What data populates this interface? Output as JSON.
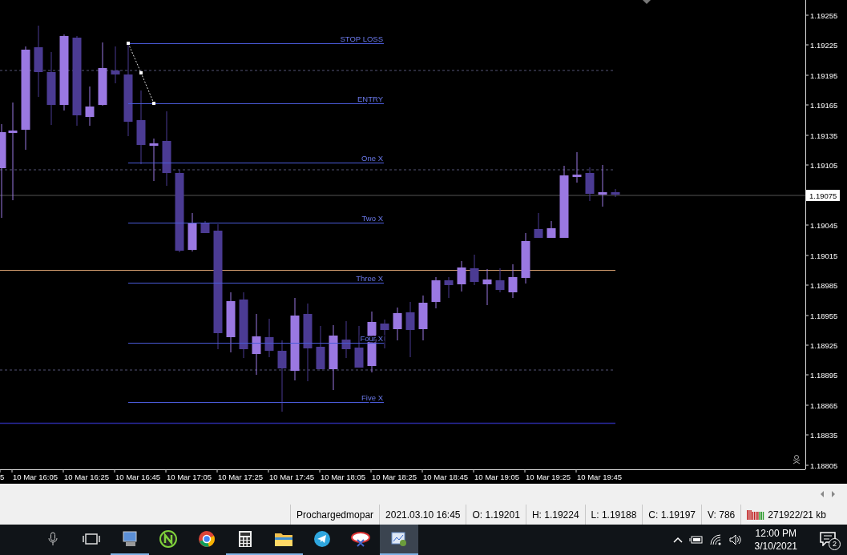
{
  "chart": {
    "levels": [
      {
        "label": "STOP LOSS"
      },
      {
        "label": "ENTRY"
      },
      {
        "label": "One X"
      },
      {
        "label": "Two X"
      },
      {
        "label": "Three X"
      },
      {
        "label": "Four X"
      },
      {
        "label": "Five X"
      }
    ],
    "price_labels": [
      "1.19255",
      "1.19225",
      "1.19195",
      "1.19165",
      "1.19135",
      "1.19105",
      "1.19045",
      "1.19015",
      "1.18985",
      "1.18955",
      "1.18925",
      "1.18895",
      "1.18865",
      "1.18835",
      "1.18805"
    ],
    "current_price": "1.19075",
    "time_labels": [
      "5",
      "10 Mar 16:05",
      "10 Mar 16:25",
      "10 Mar 16:45",
      "10 Mar 17:05",
      "10 Mar 17:25",
      "10 Mar 17:45",
      "10 Mar 18:05",
      "10 Mar 18:25",
      "10 Mar 18:45",
      "10 Mar 19:05",
      "10 Mar 19:25",
      "10 Mar 19:45"
    ]
  },
  "status_bar": {
    "cells": [
      "Prochargedmopar",
      "2021.03.10 16:45",
      "O: 1.19201",
      "H: 1.19224",
      "L: 1.19188",
      "C: 1.19197",
      "V: 786"
    ],
    "memory": "271922/21 kb"
  },
  "taskbar": {
    "apps": [
      {
        "running": true,
        "selected": false
      },
      {
        "running": false,
        "selected": false
      },
      {
        "running": false,
        "selected": false
      },
      {
        "running": true,
        "selected": false
      },
      {
        "running": true,
        "selected": false
      },
      {
        "running": false,
        "selected": false
      },
      {
        "running": false,
        "selected": false
      },
      {
        "running": true,
        "selected": true
      }
    ],
    "time": "12:00 PM",
    "date": "3/10/2021",
    "notifications": "2"
  }
}
